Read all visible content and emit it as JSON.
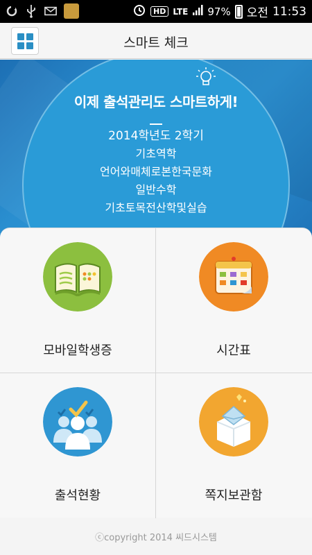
{
  "status_bar": {
    "battery": "97%",
    "network": "LTE",
    "hd": "HD",
    "ampm": "오전",
    "time": "11:53"
  },
  "app_bar": {
    "title": "스마트 체크"
  },
  "hero": {
    "slogan": "이제 출석관리도 스마트하게!",
    "semester": "2014학년도 2학기",
    "courses": [
      "기초역학",
      "언어와매체로본한국문화",
      "일반수학",
      "기초토목전산학및실습"
    ]
  },
  "menu": [
    {
      "label": "모바일학생증",
      "icon": "open-book-icon",
      "color": "#8cbf3f"
    },
    {
      "label": "시간표",
      "icon": "calendar-icon",
      "color": "#f08a24"
    },
    {
      "label": "출석현황",
      "icon": "students-check-icon",
      "color": "#2f96d2"
    },
    {
      "label": "쪽지보관함",
      "icon": "message-box-icon",
      "color": "#f2a630"
    }
  ],
  "footer": {
    "copyright": "ⓒcopyright 2014 씨드시스템"
  }
}
